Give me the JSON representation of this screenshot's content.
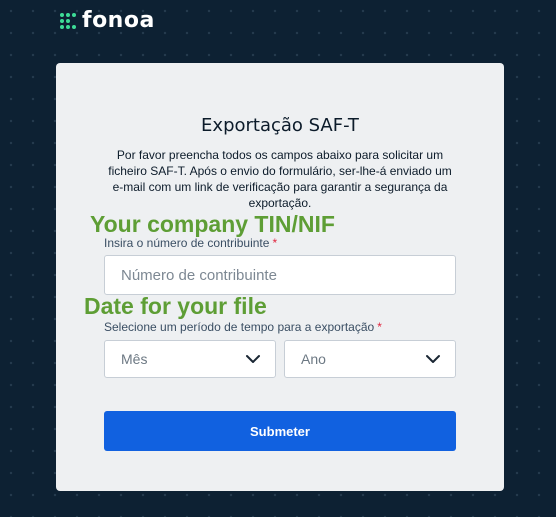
{
  "brand": {
    "name": "fonoa",
    "accent_color": "#3ddc97",
    "icon": "fonoa-dots-logo-icon"
  },
  "form": {
    "title": "Exportação SAF-T",
    "description": "Por favor preencha todos os campos abaixo para solicitar um ficheiro SAF-T. Após o envio do formulário, ser-lhe-á enviado um e-mail com um link de verificação para garantir a segurança da exportação.",
    "tin_label": "Insira o número de contribuinte",
    "tin_required": "*",
    "tin_placeholder": "Número de contribuinte",
    "tin_value": "",
    "period_label": "Selecione um período de tempo para a exportação",
    "period_required": "*",
    "month_select": {
      "selected": "Mês",
      "icon": "chevron-down-icon"
    },
    "year_select": {
      "selected": "Ano",
      "icon": "chevron-down-icon"
    },
    "submit_label": "Submeter",
    "submit_color": "#1161e0"
  },
  "annotations": {
    "tin_note": "Your company TIN/NIF",
    "date_note": "Date for your file",
    "color": "#5e9e35"
  }
}
